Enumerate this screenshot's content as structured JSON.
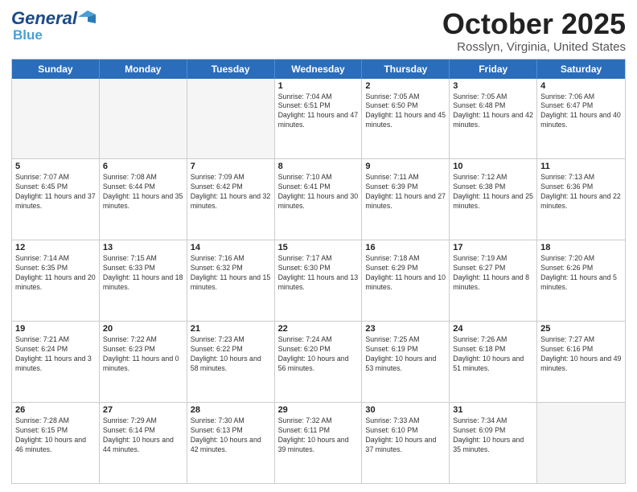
{
  "header": {
    "logo": {
      "line1": "General",
      "line2": "Blue"
    },
    "title": "October 2025",
    "location": "Rosslyn, Virginia, United States"
  },
  "calendar": {
    "days_of_week": [
      "Sunday",
      "Monday",
      "Tuesday",
      "Wednesday",
      "Thursday",
      "Friday",
      "Saturday"
    ],
    "weeks": [
      [
        {
          "day": "",
          "empty": true
        },
        {
          "day": "",
          "empty": true
        },
        {
          "day": "",
          "empty": true
        },
        {
          "day": "1",
          "sunrise": "7:04 AM",
          "sunset": "6:51 PM",
          "daylight": "11 hours and 47 minutes."
        },
        {
          "day": "2",
          "sunrise": "7:05 AM",
          "sunset": "6:50 PM",
          "daylight": "11 hours and 45 minutes."
        },
        {
          "day": "3",
          "sunrise": "7:05 AM",
          "sunset": "6:48 PM",
          "daylight": "11 hours and 42 minutes."
        },
        {
          "day": "4",
          "sunrise": "7:06 AM",
          "sunset": "6:47 PM",
          "daylight": "11 hours and 40 minutes."
        }
      ],
      [
        {
          "day": "5",
          "sunrise": "7:07 AM",
          "sunset": "6:45 PM",
          "daylight": "11 hours and 37 minutes."
        },
        {
          "day": "6",
          "sunrise": "7:08 AM",
          "sunset": "6:44 PM",
          "daylight": "11 hours and 35 minutes."
        },
        {
          "day": "7",
          "sunrise": "7:09 AM",
          "sunset": "6:42 PM",
          "daylight": "11 hours and 32 minutes."
        },
        {
          "day": "8",
          "sunrise": "7:10 AM",
          "sunset": "6:41 PM",
          "daylight": "11 hours and 30 minutes."
        },
        {
          "day": "9",
          "sunrise": "7:11 AM",
          "sunset": "6:39 PM",
          "daylight": "11 hours and 27 minutes."
        },
        {
          "day": "10",
          "sunrise": "7:12 AM",
          "sunset": "6:38 PM",
          "daylight": "11 hours and 25 minutes."
        },
        {
          "day": "11",
          "sunrise": "7:13 AM",
          "sunset": "6:36 PM",
          "daylight": "11 hours and 22 minutes."
        }
      ],
      [
        {
          "day": "12",
          "sunrise": "7:14 AM",
          "sunset": "6:35 PM",
          "daylight": "11 hours and 20 minutes."
        },
        {
          "day": "13",
          "sunrise": "7:15 AM",
          "sunset": "6:33 PM",
          "daylight": "11 hours and 18 minutes."
        },
        {
          "day": "14",
          "sunrise": "7:16 AM",
          "sunset": "6:32 PM",
          "daylight": "11 hours and 15 minutes."
        },
        {
          "day": "15",
          "sunrise": "7:17 AM",
          "sunset": "6:30 PM",
          "daylight": "11 hours and 13 minutes."
        },
        {
          "day": "16",
          "sunrise": "7:18 AM",
          "sunset": "6:29 PM",
          "daylight": "11 hours and 10 minutes."
        },
        {
          "day": "17",
          "sunrise": "7:19 AM",
          "sunset": "6:27 PM",
          "daylight": "11 hours and 8 minutes."
        },
        {
          "day": "18",
          "sunrise": "7:20 AM",
          "sunset": "6:26 PM",
          "daylight": "11 hours and 5 minutes."
        }
      ],
      [
        {
          "day": "19",
          "sunrise": "7:21 AM",
          "sunset": "6:24 PM",
          "daylight": "11 hours and 3 minutes."
        },
        {
          "day": "20",
          "sunrise": "7:22 AM",
          "sunset": "6:23 PM",
          "daylight": "11 hours and 0 minutes."
        },
        {
          "day": "21",
          "sunrise": "7:23 AM",
          "sunset": "6:22 PM",
          "daylight": "10 hours and 58 minutes."
        },
        {
          "day": "22",
          "sunrise": "7:24 AM",
          "sunset": "6:20 PM",
          "daylight": "10 hours and 56 minutes."
        },
        {
          "day": "23",
          "sunrise": "7:25 AM",
          "sunset": "6:19 PM",
          "daylight": "10 hours and 53 minutes."
        },
        {
          "day": "24",
          "sunrise": "7:26 AM",
          "sunset": "6:18 PM",
          "daylight": "10 hours and 51 minutes."
        },
        {
          "day": "25",
          "sunrise": "7:27 AM",
          "sunset": "6:16 PM",
          "daylight": "10 hours and 49 minutes."
        }
      ],
      [
        {
          "day": "26",
          "sunrise": "7:28 AM",
          "sunset": "6:15 PM",
          "daylight": "10 hours and 46 minutes."
        },
        {
          "day": "27",
          "sunrise": "7:29 AM",
          "sunset": "6:14 PM",
          "daylight": "10 hours and 44 minutes."
        },
        {
          "day": "28",
          "sunrise": "7:30 AM",
          "sunset": "6:13 PM",
          "daylight": "10 hours and 42 minutes."
        },
        {
          "day": "29",
          "sunrise": "7:32 AM",
          "sunset": "6:11 PM",
          "daylight": "10 hours and 39 minutes."
        },
        {
          "day": "30",
          "sunrise": "7:33 AM",
          "sunset": "6:10 PM",
          "daylight": "10 hours and 37 minutes."
        },
        {
          "day": "31",
          "sunrise": "7:34 AM",
          "sunset": "6:09 PM",
          "daylight": "10 hours and 35 minutes."
        },
        {
          "day": "",
          "empty": true
        }
      ]
    ],
    "labels": {
      "sunrise": "Sunrise:",
      "sunset": "Sunset:",
      "daylight": "Daylight:"
    }
  }
}
